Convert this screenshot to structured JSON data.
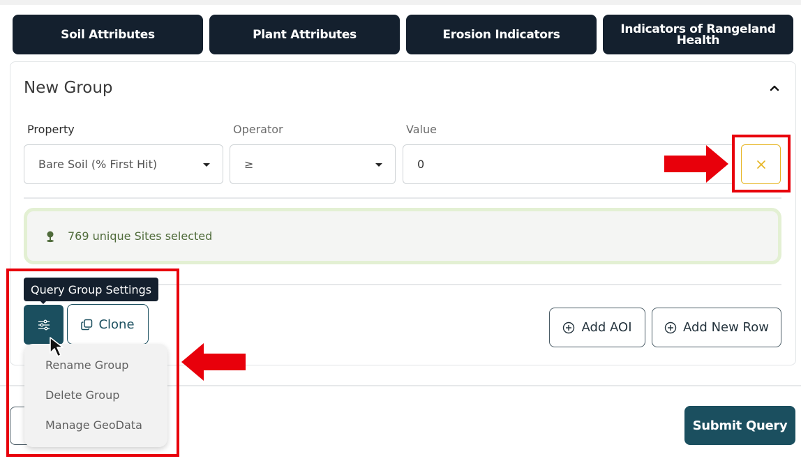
{
  "tabs": [
    {
      "label": "Soil Attributes"
    },
    {
      "label": "Plant Attributes"
    },
    {
      "label": "Erosion Indicators"
    },
    {
      "label": "Indicators of Rangeland Health"
    }
  ],
  "group": {
    "title": "New Group",
    "property_label": "Property",
    "operator_label": "Operator",
    "value_label": "Value",
    "property_value": "Bare Soil (% First Hit)",
    "operator_value": "≥",
    "value": "0",
    "sites_text": "769 unique Sites selected",
    "tooltip": "Query Group Settings",
    "clone_label": "Clone",
    "add_aoi_label": "Add AOI",
    "add_row_label": "Add New Row"
  },
  "settings_menu": [
    {
      "label": "Rename Group"
    },
    {
      "label": "Delete Group"
    },
    {
      "label": "Manage GeoData"
    }
  ],
  "footer": {
    "submit_label": "Submit Query"
  },
  "colors": {
    "tab_bg": "#14202e",
    "primary": "#1b4f5f",
    "remove_accent": "#e6b420",
    "sites_border": "#e3f0d3",
    "annotation": "#e8000b"
  }
}
